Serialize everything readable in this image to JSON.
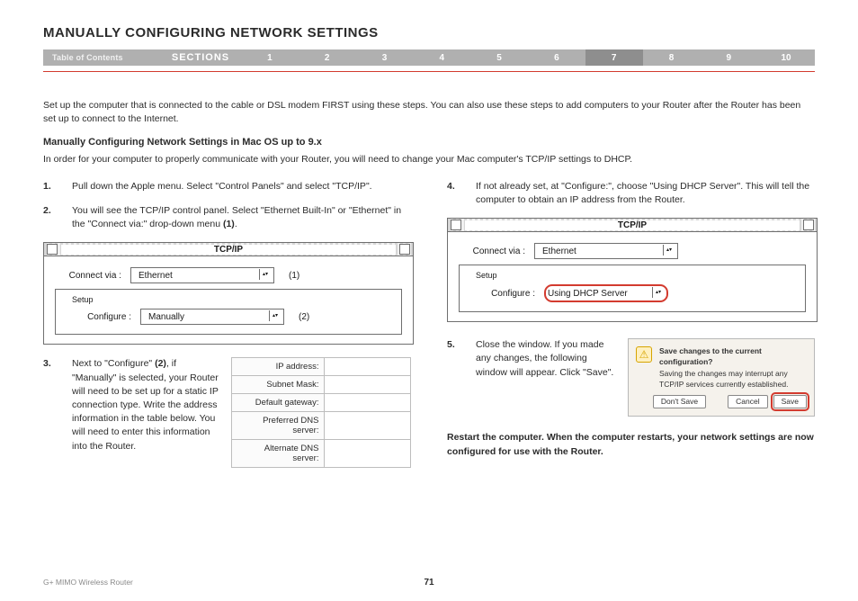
{
  "header": {
    "title": "MANUALLY CONFIGURING NETWORK SETTINGS",
    "nav": {
      "toc": "Table of Contents",
      "sections_label": "SECTIONS",
      "numbers": [
        "1",
        "2",
        "3",
        "4",
        "5",
        "6",
        "7",
        "8",
        "9",
        "10"
      ],
      "active": "7"
    }
  },
  "intro": "Set up the computer that is connected to the cable or DSL modem FIRST using these steps. You can also use these steps to add computers to your Router after the Router has been set up to connect to the Internet.",
  "subhead": "Manually Configuring Network Settings in Mac OS up to 9.x",
  "intro2": "In order for your computer to properly communicate with your Router, you will need to change your Mac computer's TCP/IP settings to DHCP.",
  "left": {
    "steps": {
      "s1": {
        "num": "1.",
        "text": "Pull down the Apple menu. Select \"Control Panels\" and select \"TCP/IP\"."
      },
      "s2": {
        "num": "2.",
        "pre": "You will see the TCP/IP control panel. Select \"Ethernet Built-In\" or \"Ethernet\" in the \"Connect via:\" drop-down menu ",
        "bold": "(1)",
        "post": "."
      },
      "s3": {
        "num": "3.",
        "pre": "Next to \"Configure\" ",
        "bold": "(2)",
        "post": ", if \"Manually\" is selected, your Router will need to be set up for a static IP connection type. Write the address information in the table below. You will need to enter this information into the Router."
      }
    },
    "figure1": {
      "title": "TCP/IP",
      "connect_label": "Connect via :",
      "connect_value": "Ethernet",
      "setup_label": "Setup",
      "configure_label": "Configure :",
      "configure_value": "Manually",
      "annot1": "(1)",
      "annot2": "(2)"
    },
    "table": {
      "rows": [
        {
          "label": "IP address:",
          "value": ""
        },
        {
          "label": "Subnet Mask:",
          "value": ""
        },
        {
          "label": "Default gateway:",
          "value": ""
        },
        {
          "label": "Preferred DNS server:",
          "value": ""
        },
        {
          "label": "Alternate DNS server:",
          "value": ""
        }
      ]
    }
  },
  "right": {
    "steps": {
      "s4": {
        "num": "4.",
        "text": "If not already set, at \"Configure:\", choose \"Using DHCP Server\". This will tell the computer to obtain an IP address from the Router."
      },
      "s5": {
        "num": "5.",
        "text": "Close the window. If you made any changes, the following window will appear. Click \"Save\"."
      }
    },
    "figure2": {
      "title": "TCP/IP",
      "connect_label": "Connect via :",
      "connect_value": "Ethernet",
      "setup_label": "Setup",
      "configure_label": "Configure :",
      "configure_value": "Using DHCP Server"
    },
    "alert": {
      "heading": "Save changes to the current configuration?",
      "body": "Saving the changes may interrupt any TCP/IP services currently established.",
      "buttons": {
        "dontsave": "Don't Save",
        "cancel": "Cancel",
        "save": "Save"
      }
    },
    "restart": "Restart the computer. When the computer restarts, your network settings are now configured for use with the Router."
  },
  "footer": {
    "product": "G+ MIMO Wireless Router",
    "page": "71"
  }
}
